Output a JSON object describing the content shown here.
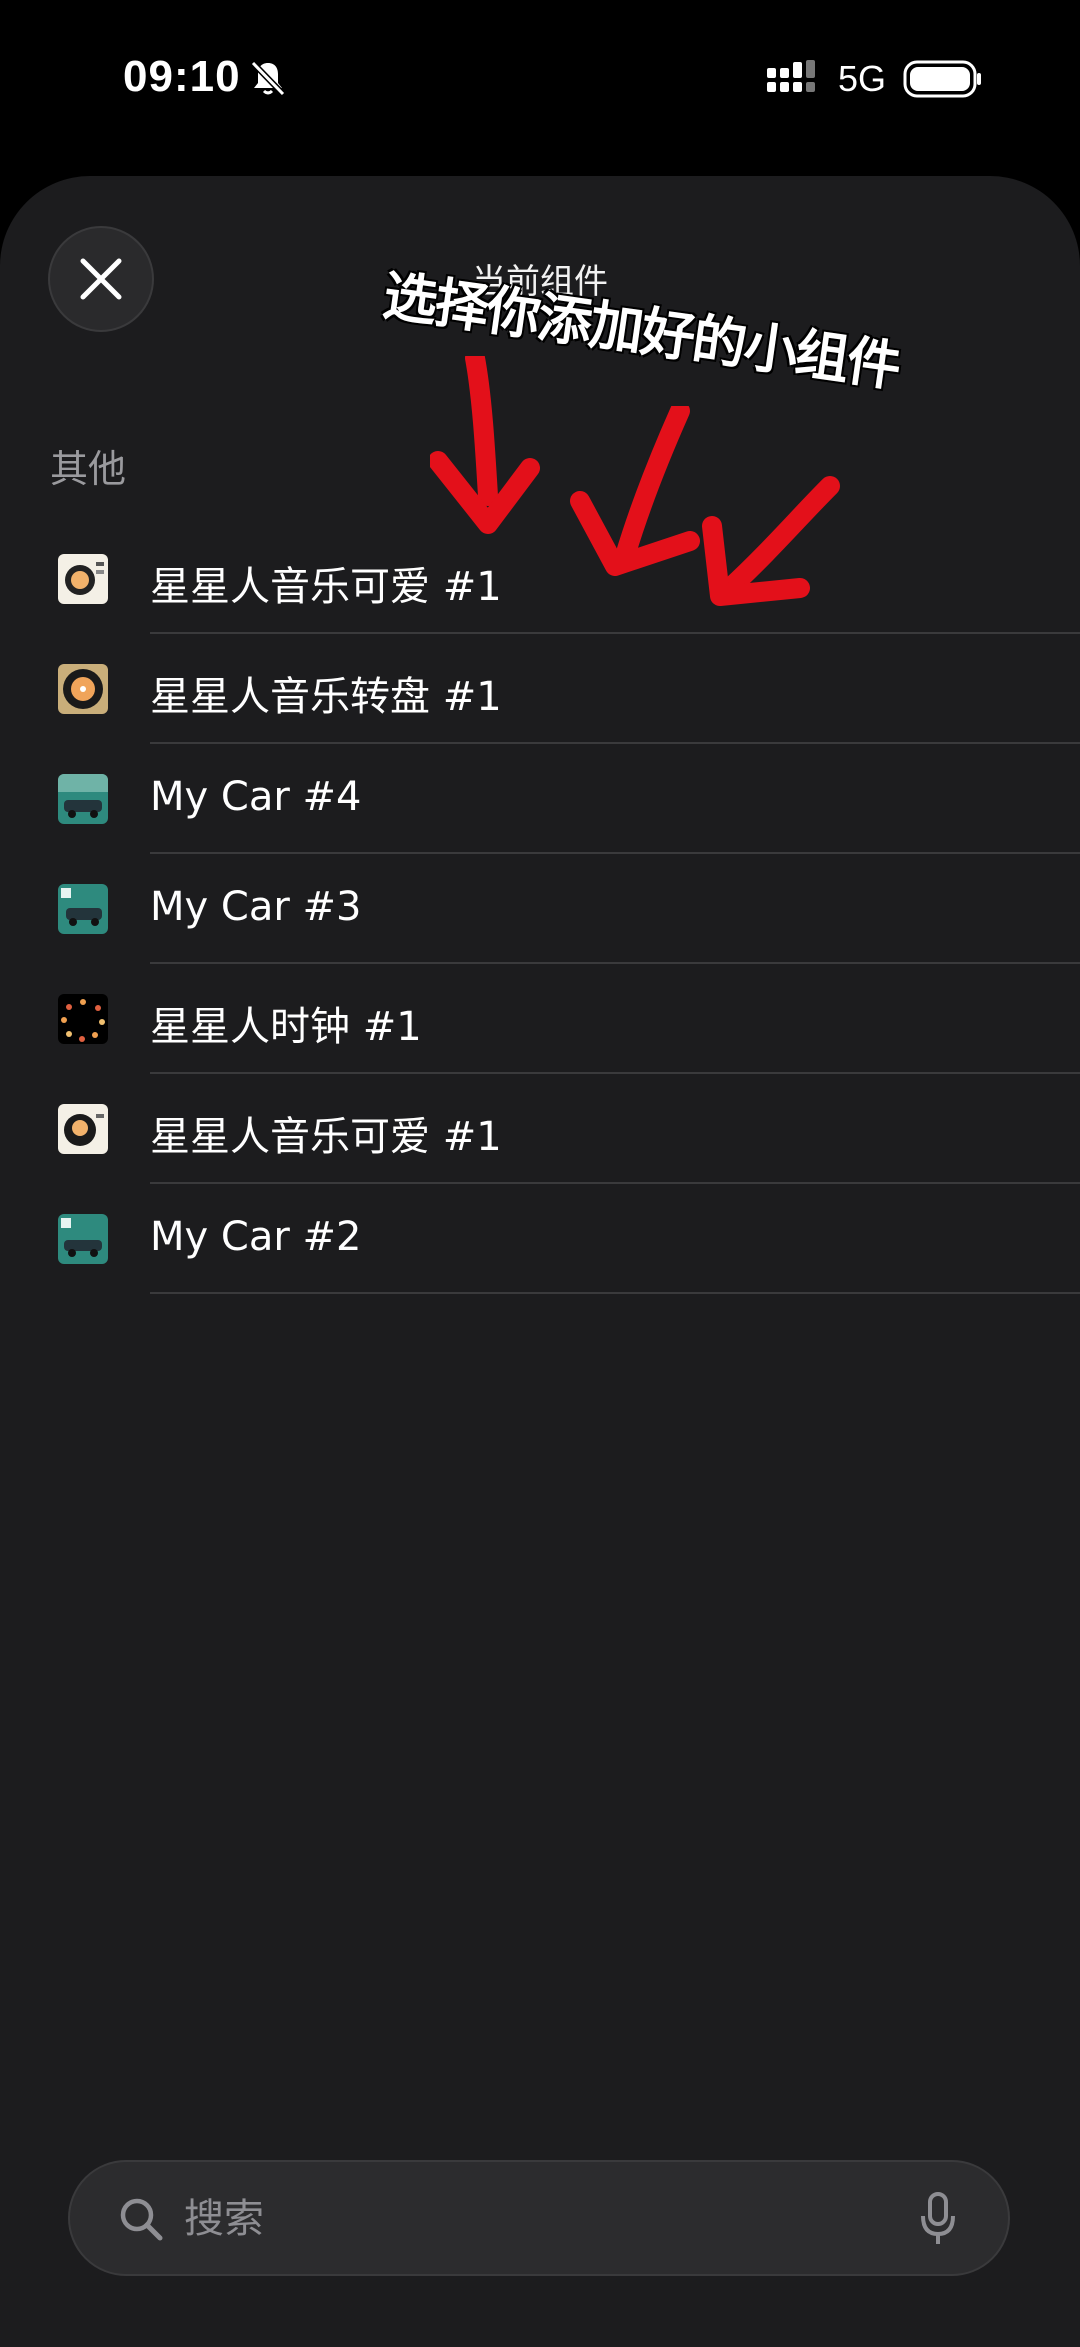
{
  "status_bar": {
    "time": "09:10",
    "network": "5G"
  },
  "sheet": {
    "title": "当前组件",
    "annotation": "选择你添加好的小组件",
    "section_header": "其他",
    "items": [
      {
        "label": "星星人音乐可爱 #1",
        "icon": "star-person-music-cute-icon"
      },
      {
        "label": "星星人音乐转盘 #1",
        "icon": "star-person-music-turntable-icon"
      },
      {
        "label": "My Car #4",
        "icon": "my-car-icon"
      },
      {
        "label": "My Car #3",
        "icon": "my-car-icon"
      },
      {
        "label": "星星人时钟 #1",
        "icon": "star-person-clock-icon"
      },
      {
        "label": "星星人音乐可爱 #1",
        "icon": "star-person-music-cute-icon"
      },
      {
        "label": "My Car #2",
        "icon": "my-car-icon"
      }
    ]
  },
  "search": {
    "placeholder": "搜索"
  },
  "colors": {
    "sheet_background": "#1c1c1e",
    "annotation_arrow": "#e3101a",
    "secondary_text": "#9a9a9e"
  }
}
